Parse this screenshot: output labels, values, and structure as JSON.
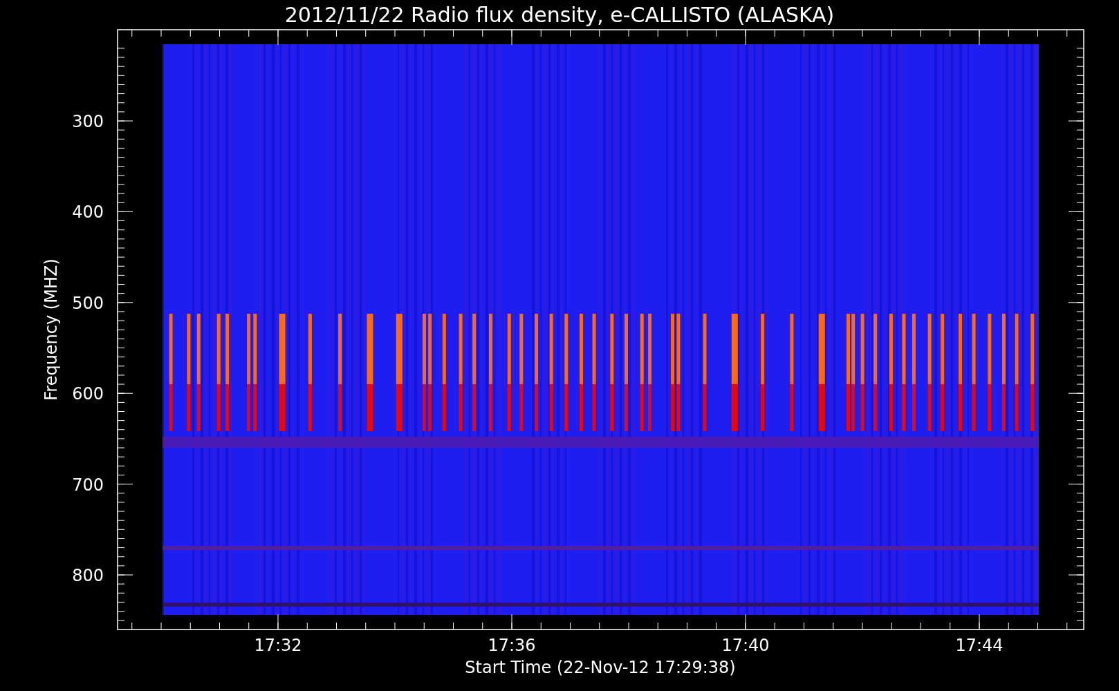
{
  "title": "2012/11/22  Radio flux density, e-CALLISTO (ALASKA)",
  "y_axis": {
    "label": "Frequency (MHZ)",
    "ticks": [
      "300",
      "400",
      "500",
      "600",
      "700",
      "800"
    ]
  },
  "x_axis": {
    "label": "Start Time (22-Nov-12 17:29:38)",
    "ticks": [
      "17:32",
      "17:36",
      "17:40",
      "17:44"
    ]
  }
}
